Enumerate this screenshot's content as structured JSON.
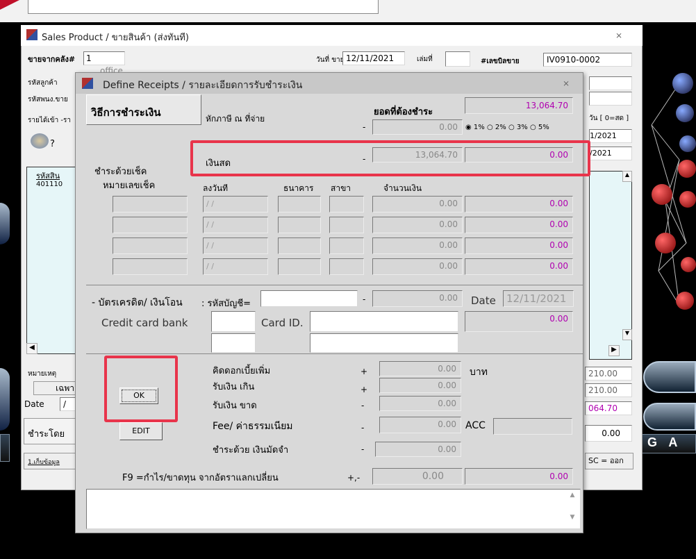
{
  "outer_window": {
    "title": "Sales Product / ขายสินค้า (ส่งทันที)",
    "close": "⨯",
    "warehouse_label": "ขายจากคลัง#",
    "warehouse_no": "1",
    "warehouse_name": "office",
    "sale_date_label": "วันที่ ขาย",
    "sale_date": "12/11/2021",
    "book_label": "เล่มที่",
    "bill_label": "#เลขบิลขาย",
    "bill_no": "IV0910-0002",
    "customer_label": "รหัสลูกค้า",
    "staff_label": "รหัสพนง.ขาย",
    "income_label": "รายได้เข้า -รา",
    "days_label": "วัน [ 0=สด ]",
    "date_right_1": "1/2021",
    "date_right_2": "/2021",
    "table_col_code": "รหัสสิน",
    "table_row_code": "401110",
    "remark_label": "หมายเหตุ",
    "special_label": "เฉพา",
    "date_label": "Date",
    "date_value": "/",
    "pay_by_label": "ชำระโดย",
    "collect_link": "1.เก็บข้อมูล",
    "esc_label": "SC = ออก",
    "total_1": "210.00",
    "total_2": "210.00",
    "total_3": "064.70",
    "total_4": "0.00"
  },
  "dialog": {
    "title": "Define Receipts / รายละเอียดการรับชำระเงิน",
    "close": "⨯",
    "method_heading": "วิธีการชำระเงิน",
    "amount_due_label": "ยอดที่ต้องชำระ",
    "amount_due": "13,064.70",
    "withholding_label": "หักภาษี ณ ที่จ่าย",
    "withholding_value": "0.00",
    "tax_rates": [
      {
        "label": "1%",
        "checked": true
      },
      {
        "label": "2%",
        "checked": false
      },
      {
        "label": "3%",
        "checked": false
      },
      {
        "label": "5%",
        "checked": false
      }
    ],
    "cash_label": "เงินสด",
    "cash_value": "13,064.70",
    "cash_input": "0.00",
    "cheque_heading": "ชำระด้วยเช็ค",
    "cheque_cols": {
      "no": "หมายเลขเช็ค",
      "date": "ลงวันที",
      "bank": "ธนาคาร",
      "branch": "สาขา",
      "amount": "จำนวนเงิน"
    },
    "cheque_rows": [
      {
        "date": "/ /",
        "amount": "0.00",
        "input": "0.00"
      },
      {
        "date": "/ /",
        "amount": "0.00",
        "input": "0.00"
      },
      {
        "date": "/ /",
        "amount": "0.00",
        "input": "0.00"
      },
      {
        "date": "/ /",
        "amount": "0.00",
        "input": "0.00"
      }
    ],
    "card_label": "- บัตรเครดิต/ เงินโอน",
    "account_label": ": รหัสบัญชี=",
    "card_amount": "0.00",
    "card_date_label": "Date",
    "card_date": "12/11/2021",
    "card_bank_label": "Credit card bank",
    "card_id_label": "Card ID.",
    "card_input": "0.00",
    "ok_label": "OK",
    "edit_label": "EDIT",
    "interest_label": "คิดดอกเบี้ยเพิ่ม",
    "interest_value": "0.00",
    "baht_label": "บาท",
    "over_label": "รับเงิน เกิน",
    "over_value": "0.00",
    "short_label": "รับเงิน ขาด",
    "short_value": "0.00",
    "fee_label": "Fee/ ค่าธรรมเนียม",
    "fee_value": "0.00",
    "acc_label": "ACC",
    "deposit_label": "ชำระด้วย เงินมัดจำ",
    "deposit_value": "0.00",
    "fx_label": "F9 =กำไร/ขาดทุน จากอัตราแลกเปลี่ยน",
    "fx_sign": "+,-",
    "fx_value": "0.00",
    "fx_input": "0.00",
    "plus": "+",
    "minus": "-"
  },
  "background": {
    "right_label": "G A"
  },
  "colors": {
    "highlight": "#e8344b",
    "amount_text": "#b000b0",
    "dialog_title_bg": "#c8c8c8"
  }
}
